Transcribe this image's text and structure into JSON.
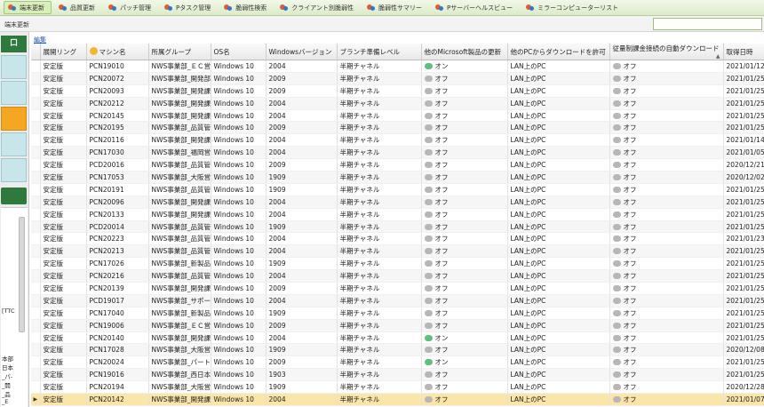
{
  "toolbar": {
    "tabs": [
      {
        "label": "端末更新",
        "active": true
      },
      {
        "label": "品質更新",
        "active": false
      },
      {
        "label": "パッチ管理",
        "active": false
      },
      {
        "label": "Pタスク管理",
        "active": false
      },
      {
        "label": "脆弱性検索",
        "active": false
      },
      {
        "label": "クライアント別脆弱性",
        "active": false
      },
      {
        "label": "脆弱性サマリー",
        "active": false
      },
      {
        "label": "Pサーバーヘルスビュー",
        "active": false
      },
      {
        "label": "ミラーコンピューターリスト",
        "active": false
      }
    ]
  },
  "subbar": {
    "title": "端末更新",
    "search_value": ""
  },
  "leftpanel": {
    "top_label": "口",
    "texts": [
      "[TTC",
      "本部",
      "日本",
      "_パ-",
      "_開",
      "_品",
      "_E"
    ]
  },
  "edit_link": "編集",
  "colors": {
    "accent": "#2d7a3c",
    "selected_row": "#fbe5a8",
    "toggle_on": "#5fbf7f",
    "toggle_off": "#b7b7b7"
  },
  "table": {
    "columns": [
      "展開リング",
      "マシン名",
      "所属グループ",
      "OS名",
      "Windowsバージョン",
      "ブランチ準備レベル",
      "他のMicrosoft製品の更新",
      "他のPCからダウンロードを許可",
      "従量制課金接続の自動ダウンロード",
      "取得日時"
    ],
    "rows": [
      [
        "安定版",
        "PCN19010",
        "NWS事業部_ＥＣ営",
        "Windows 10",
        "2004",
        "半期チャネル",
        "オン",
        "LAN上のPC",
        "オフ",
        "2021/01/12"
      ],
      [
        "安定版",
        "PCN20072",
        "NWS事業部_開発部",
        "Windows 10",
        "2009",
        "半期チャネル",
        "オフ",
        "LAN上のPC",
        "オフ",
        "2021/01/25"
      ],
      [
        "安定版",
        "PCN20093",
        "NWS事業部_開発課",
        "Windows 10",
        "2009",
        "半期チャネル",
        "オフ",
        "LAN上のPC",
        "オフ",
        "2021/01/25"
      ],
      [
        "安定版",
        "PCN20212",
        "NWS事業部_開発課",
        "Windows 10",
        "2004",
        "半期チャネル",
        "オフ",
        "LAN上のPC",
        "オフ",
        "2021/01/25"
      ],
      [
        "安定版",
        "PCN20145",
        "NWS事業部_開発課",
        "Windows 10",
        "2004",
        "半期チャネル",
        "オフ",
        "LAN上のPC",
        "オフ",
        "2021/01/25"
      ],
      [
        "安定版",
        "PCN20195",
        "NWS事業部_品質管",
        "Windows 10",
        "2009",
        "半期チャネル",
        "オフ",
        "LAN上のPC",
        "オフ",
        "2021/01/25"
      ],
      [
        "安定版",
        "PCN20116",
        "NWS事業部_開発課",
        "Windows 10",
        "2004",
        "半期チャネル",
        "オフ",
        "LAN上のPC",
        "オフ",
        "2021/01/14"
      ],
      [
        "安定版",
        "PCN17030",
        "NWS事業部_福岡営",
        "Windows 10",
        "2004",
        "半期チャネル",
        "オフ",
        "LAN上のPC",
        "オフ",
        "2021/01/05"
      ],
      [
        "安定版",
        "PCD20016",
        "NWS事業部_品質管",
        "Windows 10",
        "2009",
        "半期チャネル",
        "オフ",
        "LAN上のPC",
        "オフ",
        "2020/12/21"
      ],
      [
        "安定版",
        "PCN17053",
        "NWS事業部_大阪営",
        "Windows 10",
        "1909",
        "半期チャネル",
        "オフ",
        "LAN上のPC",
        "オフ",
        "2020/12/02"
      ],
      [
        "安定版",
        "PCN20191",
        "NWS事業部_品質管",
        "Windows 10",
        "1909",
        "半期チャネル",
        "オフ",
        "LAN上のPC",
        "オフ",
        "2021/01/25"
      ],
      [
        "安定版",
        "PCN20096",
        "NWS事業部_開発課",
        "Windows 10",
        "2004",
        "半期チャネル",
        "オフ",
        "LAN上のPC",
        "オフ",
        "2021/01/25"
      ],
      [
        "安定版",
        "PCN20133",
        "NWS事業部_開発課",
        "Windows 10",
        "2004",
        "半期チャネル",
        "オフ",
        "LAN上のPC",
        "オフ",
        "2021/01/25"
      ],
      [
        "安定版",
        "PCD20014",
        "NWS事業部_品質管",
        "Windows 10",
        "1909",
        "半期チャネル",
        "オフ",
        "LAN上のPC",
        "オフ",
        "2021/01/25"
      ],
      [
        "安定版",
        "PCN20223",
        "NWS事業部_品質管",
        "Windows 10",
        "2004",
        "半期チャネル",
        "オフ",
        "LAN上のPC",
        "オフ",
        "2021/01/23"
      ],
      [
        "安定版",
        "PCN20213",
        "NWS事業部_品質管",
        "Windows 10",
        "2004",
        "半期チャネル",
        "オフ",
        "LAN上のPC",
        "オフ",
        "2021/01/25"
      ],
      [
        "安定版",
        "PCN17026",
        "NWS事業部_新製品",
        "Windows 10",
        "1909",
        "半期チャネル",
        "オフ",
        "LAN上のPC",
        "オフ",
        "2021/01/25"
      ],
      [
        "安定版",
        "PCN20216",
        "NWS事業部_品質管",
        "Windows 10",
        "2004",
        "半期チャネル",
        "オフ",
        "LAN上のPC",
        "オフ",
        "2021/01/25"
      ],
      [
        "安定版",
        "PCN20139",
        "NWS事業部_開発課",
        "Windows 10",
        "2009",
        "半期チャネル",
        "オフ",
        "LAN上のPC",
        "オフ",
        "2021/01/25"
      ],
      [
        "安定版",
        "PCD19017",
        "NWS事業部_サポー",
        "Windows 10",
        "2004",
        "半期チャネル",
        "オフ",
        "LAN上のPC",
        "オフ",
        "2021/01/25"
      ],
      [
        "安定版",
        "PCN17040",
        "NWS事業部_新製品",
        "Windows 10",
        "1909",
        "半期チャネル",
        "オフ",
        "LAN上のPC",
        "オフ",
        "2021/01/25"
      ],
      [
        "安定版",
        "PCN19006",
        "NWS事業部_ＥＣ営",
        "Windows 10",
        "2009",
        "半期チャネル",
        "オフ",
        "LAN上のPC",
        "オフ",
        "2021/01/25"
      ],
      [
        "安定版",
        "PCN20140",
        "NWS事業部_開発課",
        "Windows 10",
        "2004",
        "半期チャネル",
        "オン",
        "LAN上のPC",
        "オフ",
        "2021/01/25"
      ],
      [
        "安定版",
        "PCN17028",
        "NWS事業部_大阪営",
        "Windows 10",
        "1909",
        "半期チャネル",
        "オフ",
        "LAN上のPC",
        "オフ",
        "2020/12/08"
      ],
      [
        "安定版",
        "PCN20024",
        "NWS事業部_パート",
        "Windows 10",
        "2009",
        "半期チャネル",
        "オン",
        "LAN上のPC",
        "オフ",
        "2021/01/25"
      ],
      [
        "安定版",
        "PCN19016",
        "NWS事業部_西日本",
        "Windows 10",
        "1903",
        "半期チャネル",
        "オフ",
        "LAN上のPC",
        "オフ",
        "2021/01/25"
      ],
      [
        "安定版",
        "PCN20194",
        "NWS事業部_大阪営",
        "Windows 10",
        "1909",
        "半期チャネル",
        "オフ",
        "LAN上のPC",
        "オフ",
        "2020/12/28"
      ],
      [
        "安定版",
        "PCN20142",
        "NWS事業部_開発課",
        "Windows 10",
        "2004",
        "半期チャネル",
        "オフ",
        "LAN上のPC",
        "オフ",
        "2021/01/07"
      ]
    ],
    "selected_row": 27
  }
}
